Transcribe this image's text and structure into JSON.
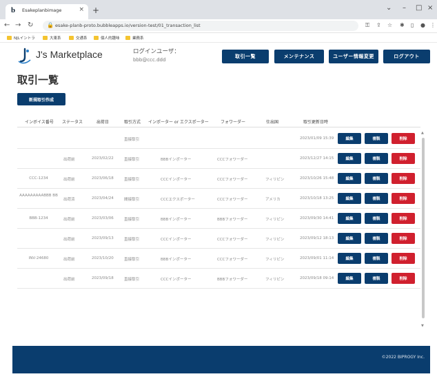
{
  "browser": {
    "tab_title": "Esakeplanbimage",
    "tab_favicon": "b",
    "tab_close": "×",
    "new_tab": "+",
    "url": "esake-planb-proto.bubbleapps.io/version-test/01_transaction_list",
    "bookmarks": [
      "NJLイントラ",
      "大東系",
      "交通系",
      "個人的趣味",
      "業務系"
    ]
  },
  "header": {
    "logo_text": "J's Marketplace",
    "login_label": "ログインユーザ：",
    "login_user": "bbb@ccc.ddd",
    "nav": [
      "取引一覧",
      "メンテナンス",
      "ユーザー情報変更",
      "ログアウト"
    ]
  },
  "page": {
    "title": "取引一覧",
    "create_button": "新規取引作成"
  },
  "table": {
    "headers": [
      "インボイス番号",
      "ステータス",
      "出荷日",
      "取引方式",
      "インポーター or エクスポーター",
      "フォワーダー",
      "仕出国",
      "取引更新日時"
    ],
    "actions": {
      "edit": "編集",
      "copy": "複製",
      "delete": "削除"
    },
    "rows": [
      {
        "invoice": "",
        "status": "",
        "ship_date": "",
        "method": "直接取引",
        "party": "",
        "forwarder": "",
        "country": "",
        "updated": "2023/01/09 15:39"
      },
      {
        "invoice": "",
        "status": "出荷前",
        "ship_date": "2023/02/22",
        "method": "直接取引",
        "party": "BBBインポーター",
        "forwarder": "CCCフォワーダー",
        "country": "",
        "updated": "2023/12/27 14:15"
      },
      {
        "invoice": "CCC-1234",
        "status": "出荷前",
        "ship_date": "2023/06/18",
        "method": "直接取引",
        "party": "CCCインポーター",
        "forwarder": "CCCフォワーダー",
        "country": "フィリピン",
        "updated": "2023/10/26 15:48"
      },
      {
        "invoice": "AAAAAAAAABBB BB",
        "status": "出荷済",
        "ship_date": "2023/04/24",
        "method": "間接取引",
        "party": "CCCエクスポーター",
        "forwarder": "CCCフォワーダー",
        "country": "アメリカ",
        "updated": "2023/10/18 13:25"
      },
      {
        "invoice": "BBB-1234",
        "status": "出荷前",
        "ship_date": "2023/03/06",
        "method": "直接取引",
        "party": "BBBインポーター",
        "forwarder": "BBBフォワーダー",
        "country": "フィリピン",
        "updated": "2023/09/30 14:41"
      },
      {
        "invoice": "",
        "status": "出荷前",
        "ship_date": "2023/09/13",
        "method": "直接取引",
        "party": "CCCインポーター",
        "forwarder": "CCCフォワーダー",
        "country": "フィリピン",
        "updated": "2023/09/12 18:13"
      },
      {
        "invoice": "INV-24680",
        "status": "出荷前",
        "ship_date": "2023/10/20",
        "method": "直接取引",
        "party": "BBBインポーター",
        "forwarder": "CCCフォワーダー",
        "country": "フィリピン",
        "updated": "2023/09/01 11:14"
      },
      {
        "invoice": "",
        "status": "出荷前",
        "ship_date": "2023/09/18",
        "method": "直接取引",
        "party": "CCCインポーター",
        "forwarder": "BBBフォワーダー",
        "country": "フィリピン",
        "updated": "2023/09/18 09:14"
      }
    ]
  },
  "footer": {
    "copyright": "©2022 BIPROGY Inc."
  },
  "colors": {
    "primary": "#0a3d6e",
    "danger": "#d0202e"
  }
}
